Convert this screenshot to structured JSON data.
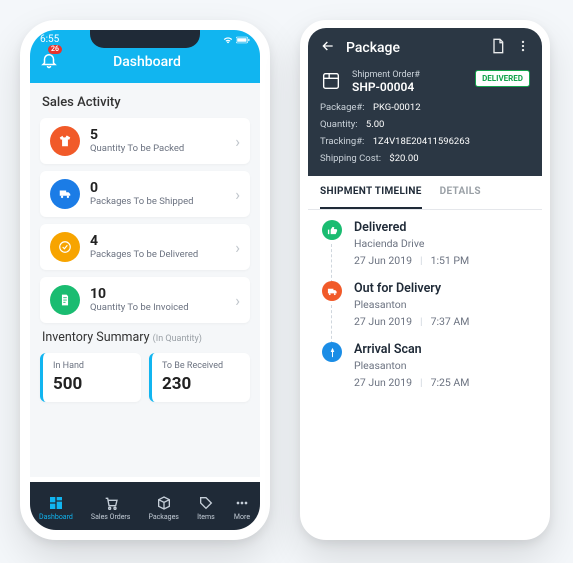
{
  "phone1": {
    "status_time": "6:55",
    "header_title": "Dashboard",
    "notif_badge": "26",
    "section_sales": "Sales Activity",
    "cards": [
      {
        "num": "5",
        "label": "Quantity To be Packed",
        "color": "#f15a29"
      },
      {
        "num": "0",
        "label": "Packages To be Shipped",
        "color": "#1b7ce6"
      },
      {
        "num": "4",
        "label": "Packages To be Delivered",
        "color": "#f7a400"
      },
      {
        "num": "10",
        "label": "Quantity To be Invoiced",
        "color": "#1abc71"
      }
    ],
    "inv_title": "Inventory Summary",
    "inv_sub": "(In Quantity)",
    "inv": [
      {
        "label": "In Hand",
        "value": "500"
      },
      {
        "label": "To Be Received",
        "value": "230"
      }
    ],
    "tabs": [
      {
        "label": "Dashboard"
      },
      {
        "label": "Sales Orders"
      },
      {
        "label": "Packages"
      },
      {
        "label": "Items"
      },
      {
        "label": "More"
      }
    ]
  },
  "phone2": {
    "header_title": "Package",
    "order_label": "Shipment Order#",
    "order_num": "SHP-00004",
    "status": "DELIVERED",
    "kv": {
      "package_k": "Package#:",
      "package_v": "PKG-00012",
      "qty_k": "Quantity:",
      "qty_v": "5.00",
      "track_k": "Tracking#:",
      "track_v": "1Z4V18E20411596263",
      "cost_k": "Shipping Cost:",
      "cost_v": "$20.00"
    },
    "tabs": {
      "timeline": "SHIPMENT TIMELINE",
      "details": "DETAILS"
    },
    "timeline": [
      {
        "title": "Delivered",
        "sub": "Hacienda Drive",
        "date": "27 Jun 2019",
        "time": "1:51 PM",
        "color": "#1abc71"
      },
      {
        "title": "Out for Delivery",
        "sub": "Pleasanton",
        "date": "27 Jun 2019",
        "time": "7:37 AM",
        "color": "#f15a29"
      },
      {
        "title": "Arrival Scan",
        "sub": "Pleasanton",
        "date": "27 Jun 2019",
        "time": "7:25 AM",
        "color": "#1b8de6"
      }
    ]
  }
}
